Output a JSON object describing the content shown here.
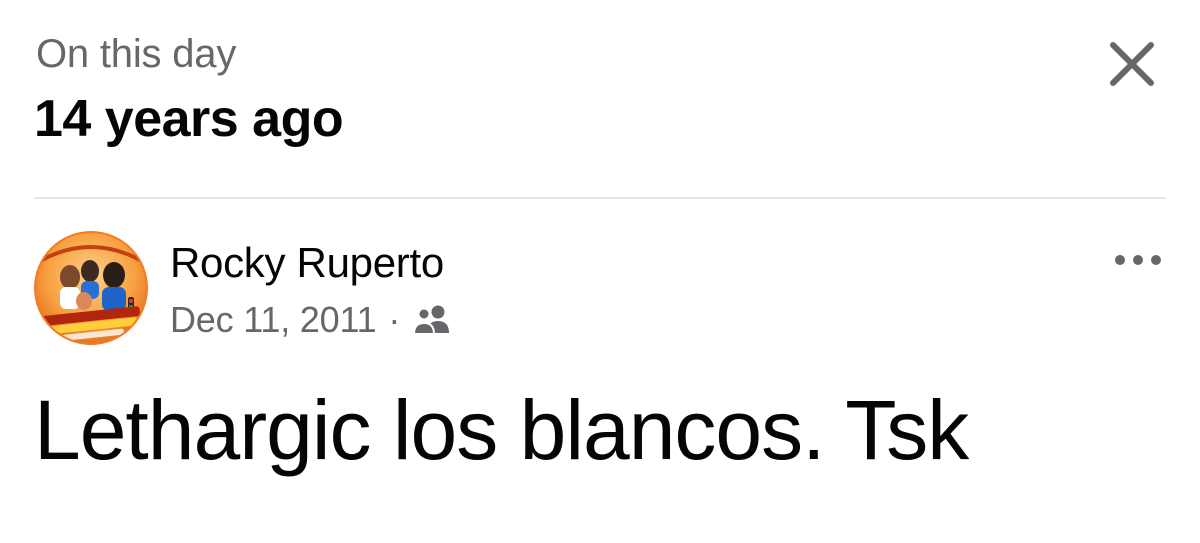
{
  "header": {
    "kicker": "On this day",
    "title": "14 years ago",
    "close_icon": "close-icon"
  },
  "post": {
    "author": "Rocky Ruperto",
    "date": "Dec 11, 2011",
    "separator": "·",
    "audience_icon": "friends-icon",
    "more_icon": "more-horizontal-icon",
    "text": "Lethargic los blancos. Tsk"
  },
  "colors": {
    "primary_text": "#050505",
    "secondary_text": "#65676b",
    "divider": "#e4e6eb",
    "avatar_accent": "#f47b20"
  }
}
